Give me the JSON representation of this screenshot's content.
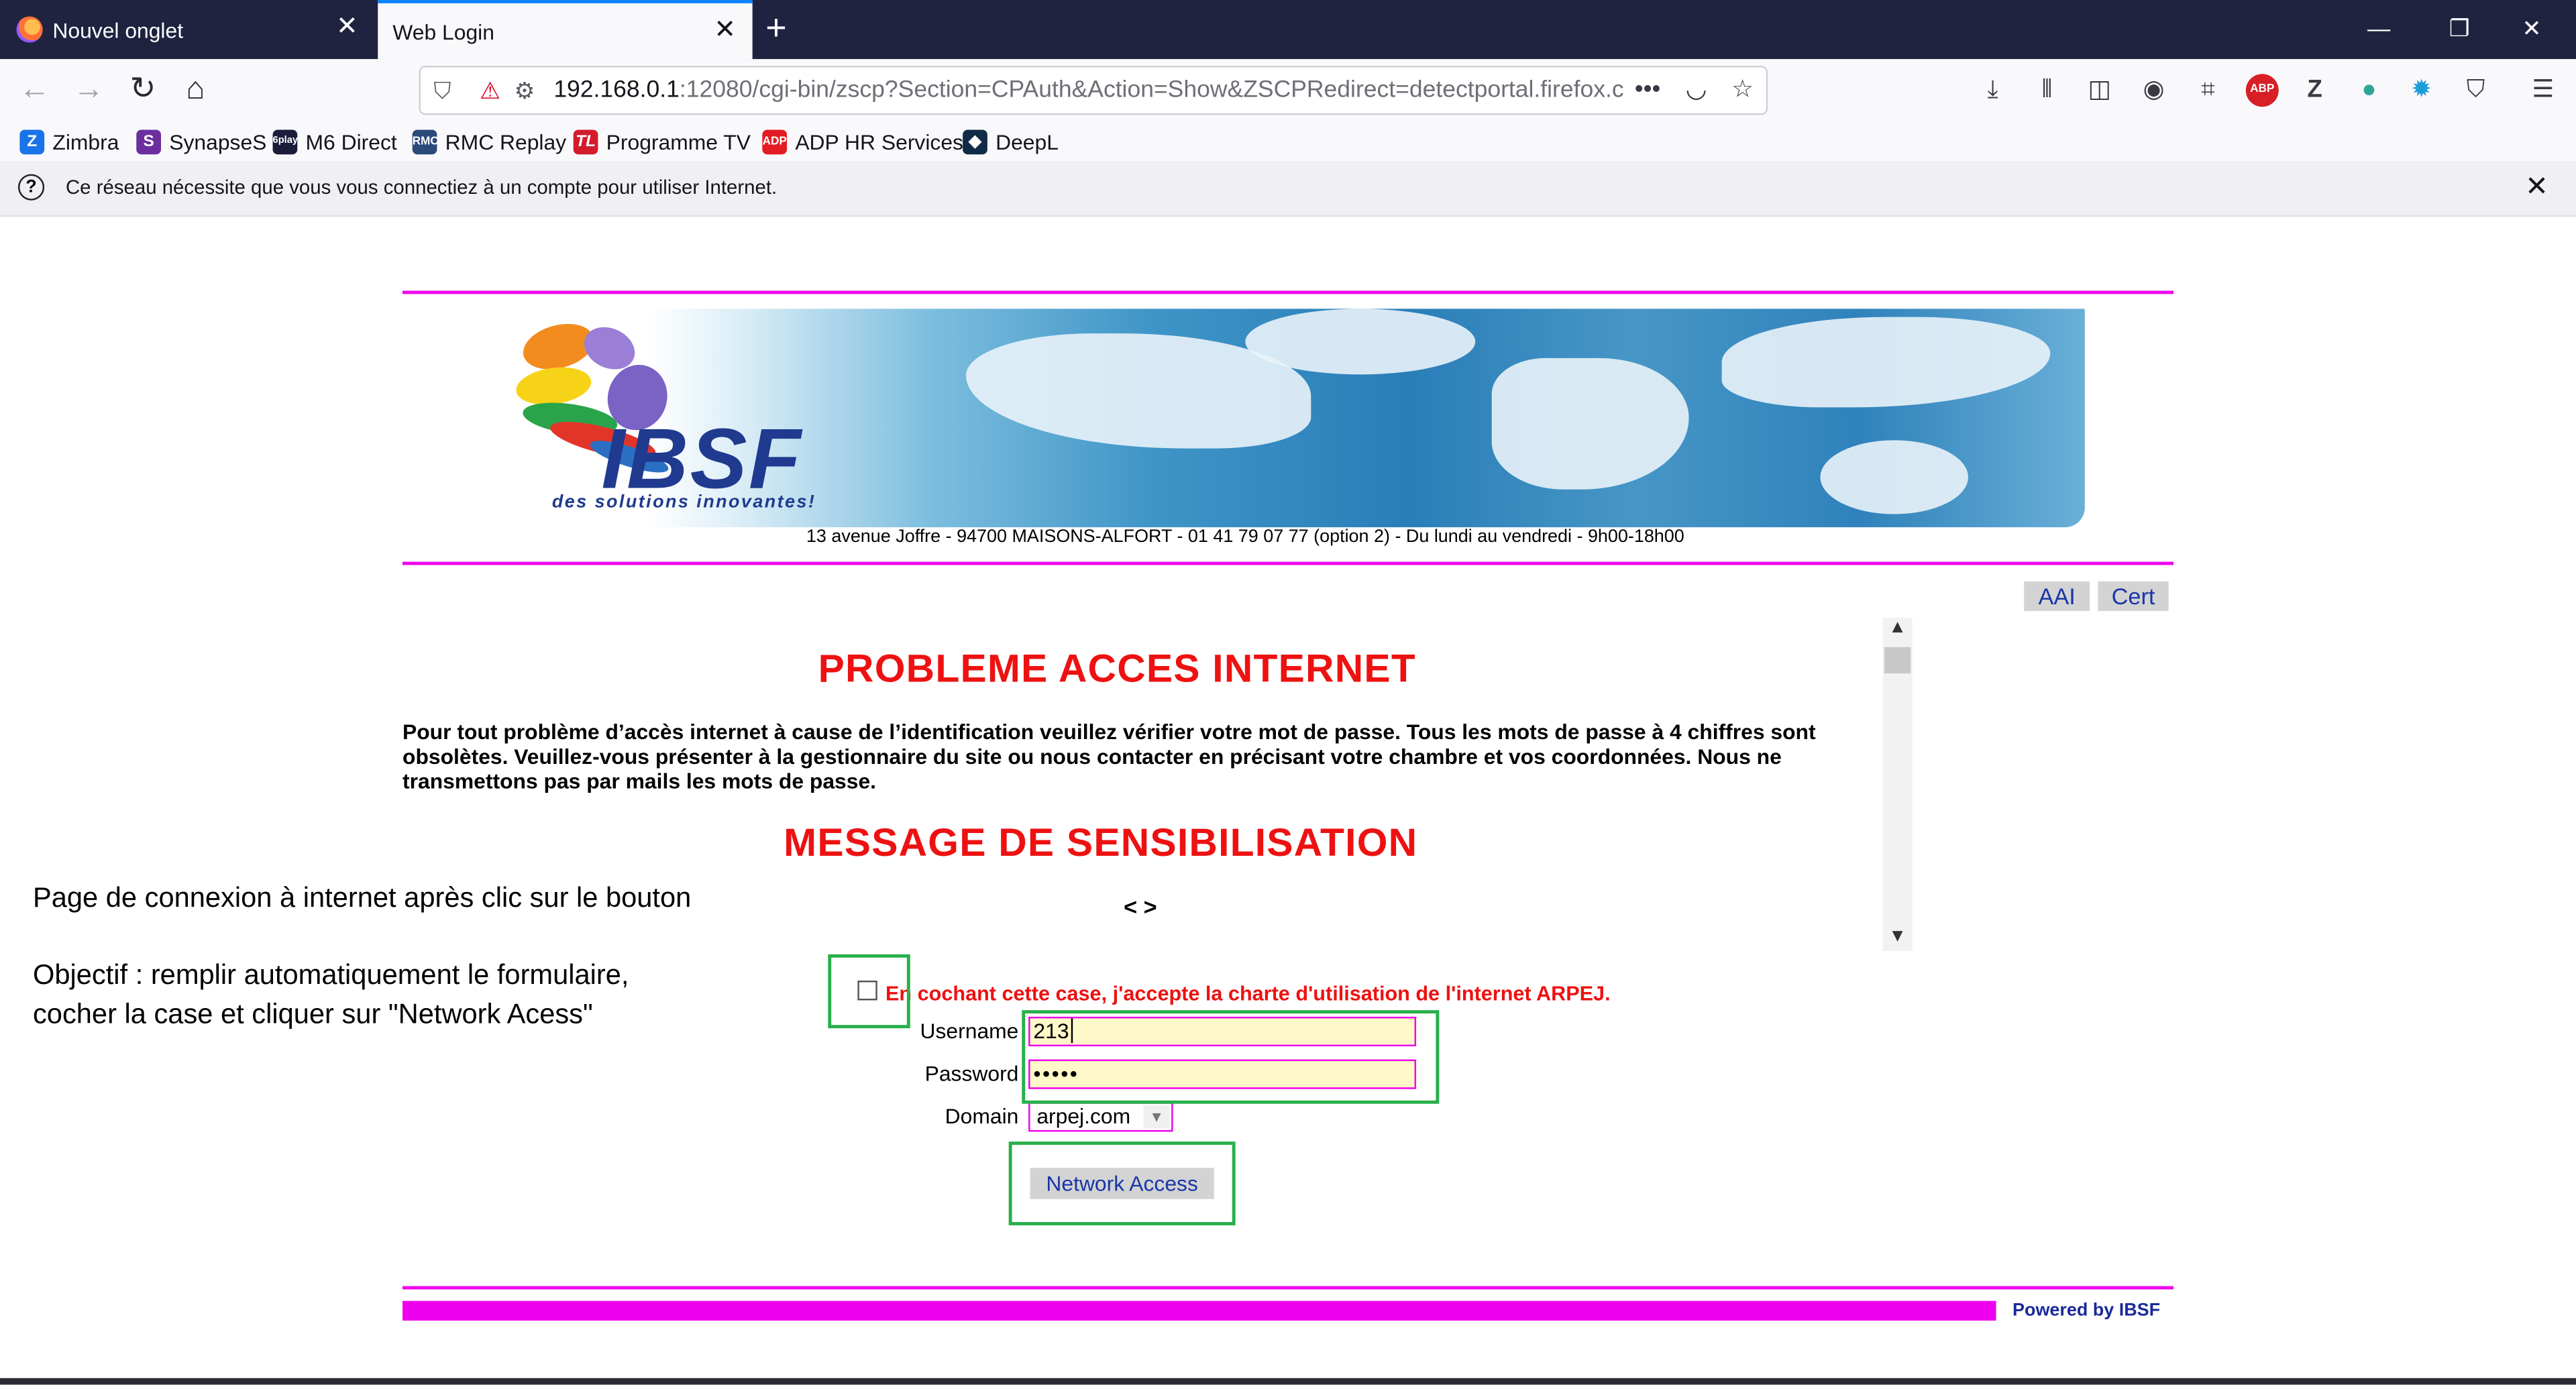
{
  "browser": {
    "tabs": [
      {
        "label": "Nouvel onglet",
        "active": false
      },
      {
        "label": "Web Login",
        "active": true
      }
    ],
    "new_tab_label": "+",
    "url_host": "192.168.0.1",
    "url_rest": ":12080/cgi-bin/zscp?Section=CPAuth&Action=Show&ZSCPRedirect=detectportal.firefox.c",
    "url_more": "•••",
    "bookmarks": [
      {
        "label": "Zimbra",
        "icon": "zimbra-icon",
        "color": "#1a73e8"
      },
      {
        "label": "SynapseS",
        "icon": "synapses-icon",
        "color": "#6b2fa0"
      },
      {
        "label": "M6 Direct",
        "icon": "6play-icon",
        "color": "#1b1b3a"
      },
      {
        "label": "RMC Replay",
        "icon": "rmc-icon",
        "color": "#2b4a7a"
      },
      {
        "label": "Programme TV",
        "icon": "tl-icon",
        "color": "#d41c2c"
      },
      {
        "label": "ADP HR Services",
        "icon": "adp-icon",
        "color": "#e31b23"
      },
      {
        "label": "DeepL",
        "icon": "deepl-icon",
        "color": "#0f2b46"
      }
    ],
    "notification": "Ce réseau nécessite que vous vous connectiez à un compte pour utiliser Internet."
  },
  "page": {
    "address": "13 avenue Joffre - 94700 MAISONS-ALFORT - 01 41 79 07 77 (option 2) - Du lundi au vendredi - 9h00-18h00",
    "logo_text": "IBSF",
    "logo_tagline": "des solutions innovantes!",
    "links": [
      "AAI",
      "Cert"
    ],
    "heading1": "PROBLEME ACCES INTERNET",
    "paragraph": "Pour tout problème d’accès internet à cause de l’identification veuillez vérifier votre mot de passe. Tous les mots de passe à 4 chiffres sont obsolètes. Veuillez-vous présenter à la gestionnaire du site ou nous contacter en précisant votre chambre et vos coordonnées. Nous ne transmettons pas par mails les mots de passe.",
    "heading2": "MESSAGE DE SENSIBILISATION",
    "arrows": "< >",
    "accept_text": "En cochant cette case, j'accepte la charte d'utilisation de l'internet ARPEJ.",
    "form": {
      "username_label": "Username",
      "username_value": "213",
      "password_label": "Password",
      "password_value": "•••••",
      "domain_label": "Domain",
      "domain_value": "arpej.com",
      "submit_label": "Network Access"
    },
    "powered_by": "Powered by IBSF"
  },
  "annotations": {
    "line1": "Page de connexion à internet après clic sur le bouton",
    "line2": "Objectif : remplir automatiquement le formulaire,",
    "line3": "cocher la case et cliquer sur \"Network Acess\""
  },
  "colors": {
    "accent_pink": "#ee00ee",
    "heading_red": "#ee1111",
    "highlight_green": "#28b04a",
    "link_blue": "#1a35a8"
  }
}
